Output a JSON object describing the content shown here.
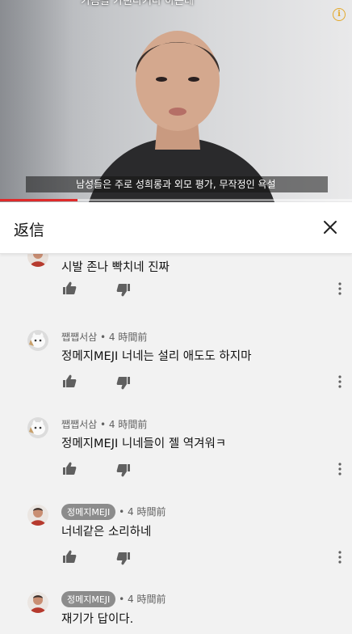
{
  "video": {
    "top_subtitle": "가슴을 가린다거나 하는데",
    "subtitle": "남성들은 주로 성희롱과 외모 평가, 무작정인 욕설",
    "progress": 0.22
  },
  "reply_panel": {
    "title": "返信"
  },
  "comments": [
    {
      "author": "",
      "author_chip": false,
      "time": "",
      "text": "시발 존나 빡치네 진짜"
    },
    {
      "author": "쨉쨉서삼",
      "author_chip": false,
      "time": "4 時間前",
      "text": "정메지MEJI 너네는 설리 애도도 하지마"
    },
    {
      "author": "쨉쨉서삼",
      "author_chip": false,
      "time": "4 時間前",
      "text": "정메지MEJI 니네들이 젤 역겨워ㅋ"
    },
    {
      "author": "정메지MEJI",
      "author_chip": true,
      "time": "4 時間前",
      "text": "너네같은 소리하네"
    },
    {
      "author": "정메지MEJI",
      "author_chip": true,
      "time": "4 時間前",
      "text": "재기가 답이다."
    }
  ],
  "separator": "•",
  "colors": {
    "progress": "#e02a2a",
    "chip": "#8c8c8c",
    "info": "#e3a92c"
  }
}
